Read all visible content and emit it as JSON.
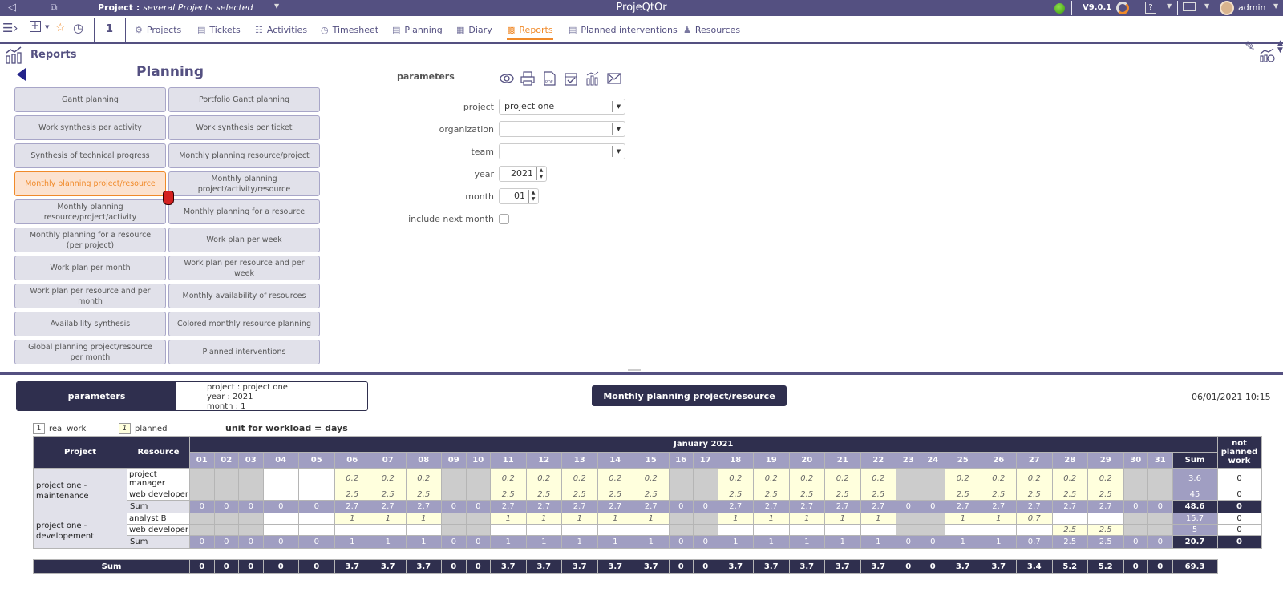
{
  "topbar": {
    "project_label": "Project :",
    "project_value": "several Projects selected",
    "app_title": "ProjeQtOr",
    "version": "V9.0.1",
    "help": "?",
    "user": "admin",
    "status_color": "#4caf20"
  },
  "navbar": {
    "count": "1",
    "items": [
      {
        "label": "Projects",
        "icon": "gear-icon"
      },
      {
        "label": "Tickets",
        "icon": "ticket-icon"
      },
      {
        "label": "Activities",
        "icon": "activity-icon"
      },
      {
        "label": "Timesheet",
        "icon": "stopwatch-icon"
      },
      {
        "label": "Planning",
        "icon": "gantt-icon"
      },
      {
        "label": "Diary",
        "icon": "calendar-icon"
      },
      {
        "label": "Reports",
        "icon": "report-icon",
        "active": true
      },
      {
        "label": "Planned interventions",
        "icon": "intervention-icon"
      },
      {
        "label": "Resources",
        "icon": "resource-icon"
      }
    ]
  },
  "reports": {
    "title": "Reports",
    "category": "Planning",
    "buttons": [
      "Gantt planning",
      "Portfolio Gantt planning",
      "Work synthesis per activity",
      "Work synthesis per ticket",
      "Synthesis of technical progress",
      "Monthly planning resource/project",
      "Monthly planning project/resource",
      "Monthly planning project/activity/resource",
      "Monthly planning resource/project/activity",
      "Monthly planning for a resource",
      "Monthly planning for a resource (per project)",
      "Work plan per week",
      "Work plan per month",
      "Work plan per resource and per week",
      "Work plan per resource and per month",
      "Monthly availability of resources",
      "Availability synthesis",
      "Colored monthly resource planning",
      "Global planning project/resource per month",
      "Planned interventions"
    ],
    "selected_index": 6
  },
  "params": {
    "title": "parameters",
    "project_label": "project",
    "project_value": "project one",
    "organization_label": "organization",
    "organization_value": "",
    "team_label": "team",
    "team_value": "",
    "year_label": "year",
    "year_value": "2021",
    "month_label": "month",
    "month_value": "01",
    "include_next_label": "include next month",
    "include_next_checked": false
  },
  "result": {
    "params_label": "parameters",
    "params_lines": [
      "project : project one",
      "year : 2021",
      "month : 1"
    ],
    "title": "Monthly planning project/resource",
    "datetime": "06/01/2021 10:15",
    "legend_real_box": "1",
    "legend_real": "real work",
    "legend_planned_box": "1",
    "legend_planned": "planned",
    "unit": "unit for workload = days",
    "col_project": "Project",
    "col_resource": "Resource",
    "month_title": "January 2021",
    "col_sum": "Sum",
    "col_npw": "not planned work",
    "days": [
      "01",
      "02",
      "03",
      "04",
      "05",
      "06",
      "07",
      "08",
      "09",
      "10",
      "11",
      "12",
      "13",
      "14",
      "15",
      "16",
      "17",
      "18",
      "19",
      "20",
      "21",
      "22",
      "23",
      "24",
      "25",
      "26",
      "27",
      "28",
      "29",
      "30",
      "31"
    ],
    "weekend": [
      1,
      2,
      3,
      9,
      10,
      16,
      17,
      23,
      24,
      30,
      31
    ],
    "projects": [
      {
        "name": "project one - maintenance",
        "rows": [
          {
            "resource": "project manager",
            "values": [
              "",
              "",
              "",
              "",
              "",
              "0.2",
              "0.2",
              "0.2",
              "",
              "",
              "0.2",
              "0.2",
              "0.2",
              "0.2",
              "0.2",
              "",
              "",
              "0.2",
              "0.2",
              "0.2",
              "0.2",
              "0.2",
              "",
              "",
              "0.2",
              "0.2",
              "0.2",
              "0.2",
              "0.2",
              "",
              ""
            ],
            "sum": "3.6",
            "npw": "0"
          },
          {
            "resource": "web developer",
            "values": [
              "",
              "",
              "",
              "",
              "",
              "2.5",
              "2.5",
              "2.5",
              "",
              "",
              "2.5",
              "2.5",
              "2.5",
              "2.5",
              "2.5",
              "",
              "",
              "2.5",
              "2.5",
              "2.5",
              "2.5",
              "2.5",
              "",
              "",
              "2.5",
              "2.5",
              "2.5",
              "2.5",
              "2.5",
              "",
              ""
            ],
            "sum": "45",
            "npw": "0"
          }
        ],
        "sum_label": "Sum",
        "sum_values": [
          "0",
          "0",
          "0",
          "0",
          "0",
          "2.7",
          "2.7",
          "2.7",
          "0",
          "0",
          "2.7",
          "2.7",
          "2.7",
          "2.7",
          "2.7",
          "0",
          "0",
          "2.7",
          "2.7",
          "2.7",
          "2.7",
          "2.7",
          "0",
          "0",
          "2.7",
          "2.7",
          "2.7",
          "2.7",
          "2.7",
          "0",
          "0"
        ],
        "sum_total": "48.6",
        "sum_npw": "0"
      },
      {
        "name": "project one - developement",
        "rows": [
          {
            "resource": "analyst B",
            "values": [
              "",
              "",
              "",
              "",
              "",
              "1",
              "1",
              "1",
              "",
              "",
              "1",
              "1",
              "1",
              "1",
              "1",
              "",
              "",
              "1",
              "1",
              "1",
              "1",
              "1",
              "",
              "",
              "1",
              "1",
              "0.7",
              "",
              "",
              "",
              ""
            ],
            "sum": "15.7",
            "npw": "0"
          },
          {
            "resource": "web developer",
            "values": [
              "",
              "",
              "",
              "",
              "",
              "",
              "",
              "",
              "",
              "",
              "",
              "",
              "",
              "",
              "",
              "",
              "",
              "",
              "",
              "",
              "",
              "",
              "",
              "",
              "",
              "",
              "",
              "2.5",
              "2.5",
              "",
              ""
            ],
            "sum": "5",
            "npw": "0"
          }
        ],
        "sum_label": "Sum",
        "sum_values": [
          "0",
          "0",
          "0",
          "0",
          "0",
          "1",
          "1",
          "1",
          "0",
          "0",
          "1",
          "1",
          "1",
          "1",
          "1",
          "0",
          "0",
          "1",
          "1",
          "1",
          "1",
          "1",
          "0",
          "0",
          "1",
          "1",
          "0.7",
          "2.5",
          "2.5",
          "0",
          "0"
        ],
        "sum_total": "20.7",
        "sum_npw": "0"
      }
    ],
    "total_label": "Sum",
    "total_values": [
      "0",
      "0",
      "0",
      "0",
      "0",
      "3.7",
      "3.7",
      "3.7",
      "0",
      "0",
      "3.7",
      "3.7",
      "3.7",
      "3.7",
      "3.7",
      "0",
      "0",
      "3.7",
      "3.7",
      "3.7",
      "3.7",
      "3.7",
      "0",
      "0",
      "3.7",
      "3.7",
      "3.4",
      "5.2",
      "5.2",
      "0",
      "0"
    ],
    "total_sum": "69.3"
  }
}
